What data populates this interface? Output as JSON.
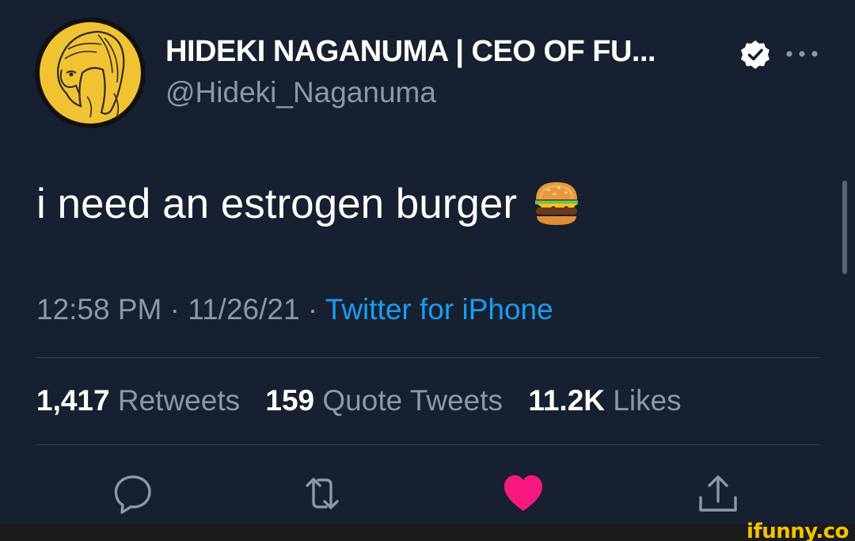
{
  "author": {
    "display_name": "HIDEKI NAGANUMA | CEO OF FU...",
    "handle": "@Hideki_Naganuma",
    "verified": true,
    "avatar_bg": "#f1c232"
  },
  "tweet": {
    "text": "i need an estrogen burger",
    "emoji": "burger-emoji"
  },
  "meta": {
    "time": "12:58 PM",
    "separator": "·",
    "date": "11/26/21",
    "source": "Twitter for iPhone"
  },
  "stats": {
    "retweets_count": "1,417",
    "retweets_label": "Retweets",
    "quotes_count": "159",
    "quotes_label": "Quote Tweets",
    "likes_count": "11.2K",
    "likes_label": "Likes"
  },
  "actions": {
    "reply_icon": "reply-icon",
    "retweet_icon": "retweet-icon",
    "like_icon": "heart-icon",
    "share_icon": "share-icon",
    "liked": true
  },
  "colors": {
    "background": "#162030",
    "accent": "#1d9bf0",
    "muted": "#8b98a5",
    "like": "#f91880"
  },
  "watermark": "ifunny.co"
}
